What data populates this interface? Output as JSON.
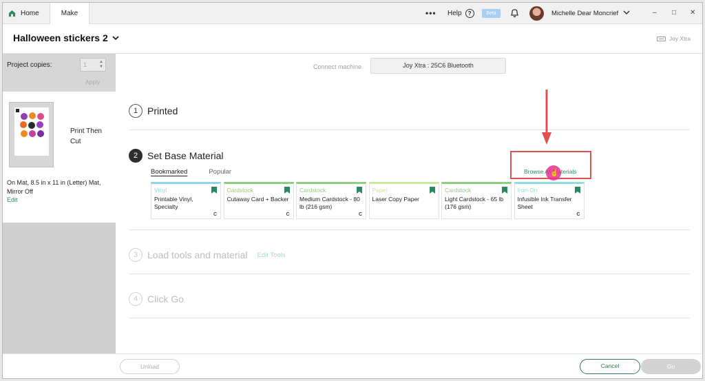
{
  "colors": {
    "accent": "#2b8a5d",
    "highlight": "#e05050",
    "cursor": "#e6328c"
  },
  "topbar": {
    "tabs": [
      {
        "label": "Home",
        "icon": "home-icon"
      },
      {
        "label": "Make"
      }
    ],
    "more": "•••",
    "help": "Help",
    "beta": "Beta",
    "user_name": "Michelle Dear Moncrief",
    "window_controls": [
      "–",
      "□",
      "✕"
    ]
  },
  "project": {
    "title": "Halloween stickers 2",
    "machine": "Joy Xtra"
  },
  "sidebar": {
    "copies_label": "Project copies:",
    "copies_value": "1",
    "apply_label": "Apply",
    "mode": "Print Then Cut",
    "mat_info": "On Mat, 8.5 in x 11 in (Letter) Mat, Mirror Off",
    "edit_label": "Edit"
  },
  "connect": {
    "label": "Connect machine",
    "device": "Joy Xtra : 25C6 Bluetooth"
  },
  "steps": [
    {
      "num": "1",
      "title": "Printed"
    },
    {
      "num": "2",
      "title": "Set Base Material"
    },
    {
      "num": "3",
      "title": "Load tools and material",
      "extra": "Edit Tools"
    },
    {
      "num": "4",
      "title": "Click Go"
    }
  ],
  "materials": {
    "tabs": [
      "Bookmarked",
      "Popular"
    ],
    "browse_label": "Browse All Materials",
    "cards": [
      {
        "category": "Vinyl",
        "name": "Printable Vinyl, Specialty",
        "color": "#8fd3ec",
        "c_badge": true
      },
      {
        "category": "Cardstock",
        "name": "Cutaway Card + Backer",
        "color": "#8fce7c",
        "c_badge": true
      },
      {
        "category": "Cardstock",
        "name": "Medium Cardstock - 80 lb (216 gsm)",
        "color": "#8fce7c",
        "c_badge": true
      },
      {
        "category": "Paper",
        "name": "Laser Copy Paper",
        "color": "#c9e99a",
        "c_badge": false
      },
      {
        "category": "Cardstock",
        "name": "Light Cardstock - 65 lb (176 gsm)",
        "color": "#8fce7c",
        "c_badge": false
      },
      {
        "category": "Iron-On",
        "name": "Infusible Ink Transfer Sheet",
        "color": "#94dcd6",
        "c_badge": true
      }
    ],
    "c_label": "C"
  },
  "footer": {
    "unload": "Unload",
    "cancel": "Cancel",
    "go": "Go"
  }
}
